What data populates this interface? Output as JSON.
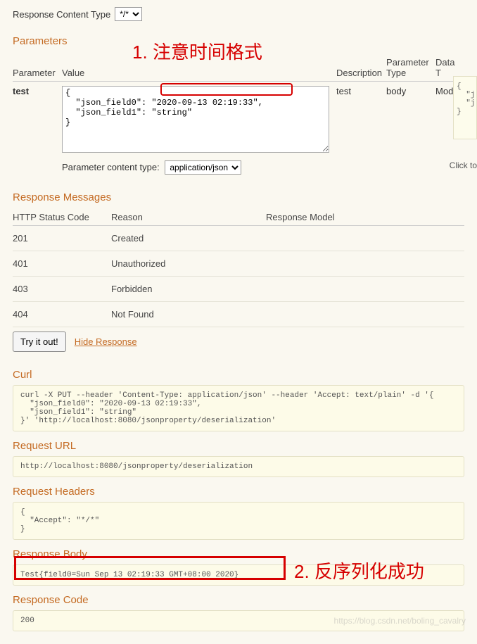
{
  "responseContentType": {
    "label": "Response Content Type",
    "value": "*/*"
  },
  "parametersTitle": "Parameters",
  "paramHeaders": {
    "parameter": "Parameter",
    "value": "Value",
    "description": "Description",
    "ptype": "Parameter Type",
    "dtype": "Data T"
  },
  "param": {
    "name": "test",
    "value": "{\n  \"json_field0\": \"2020-09-13 02:19:33\",\n  \"json_field1\": \"string\"\n}",
    "description": "test",
    "ptype": "body",
    "dtype": "Model"
  },
  "schemaBox": "{\n  \"j\n  \"j\n}",
  "clickTo": "Click to",
  "pct": {
    "label": "Parameter content type:",
    "value": "application/json"
  },
  "respMsgTitle": "Response Messages",
  "respMsgHeaders": {
    "code": "HTTP Status Code",
    "reason": "Reason",
    "model": "Response Model"
  },
  "respMsgs": [
    {
      "code": "201",
      "reason": "Created"
    },
    {
      "code": "401",
      "reason": "Unauthorized"
    },
    {
      "code": "403",
      "reason": "Forbidden"
    },
    {
      "code": "404",
      "reason": "Not Found"
    }
  ],
  "tryBtn": "Try it out!",
  "hideResp": "Hide Response",
  "curlTitle": "Curl",
  "curlBody": "curl -X PUT --header 'Content-Type: application/json' --header 'Accept: text/plain' -d '{\n  \"json_field0\": \"2020-09-13 02:19:33\",\n  \"json_field1\": \"string\"\n}' 'http://localhost:8080/jsonproperty/deserialization'",
  "reqUrlTitle": "Request URL",
  "reqUrl": "http://localhost:8080/jsonproperty/deserialization",
  "reqHeadersTitle": "Request Headers",
  "reqHeaders": "{\n  \"Accept\": \"*/*\"\n}",
  "respBodyTitle": "Response Body",
  "respBody": "Test{field0=Sun Sep 13 02:19:33 GMT+08:00 2020}",
  "respCodeTitle": "Response Code",
  "respCode": "200",
  "annotations": {
    "a1": "1. 注意时间格式",
    "a2": "2. 反序列化成功"
  },
  "watermark": "https://blog.csdn.net/boling_cavalry"
}
